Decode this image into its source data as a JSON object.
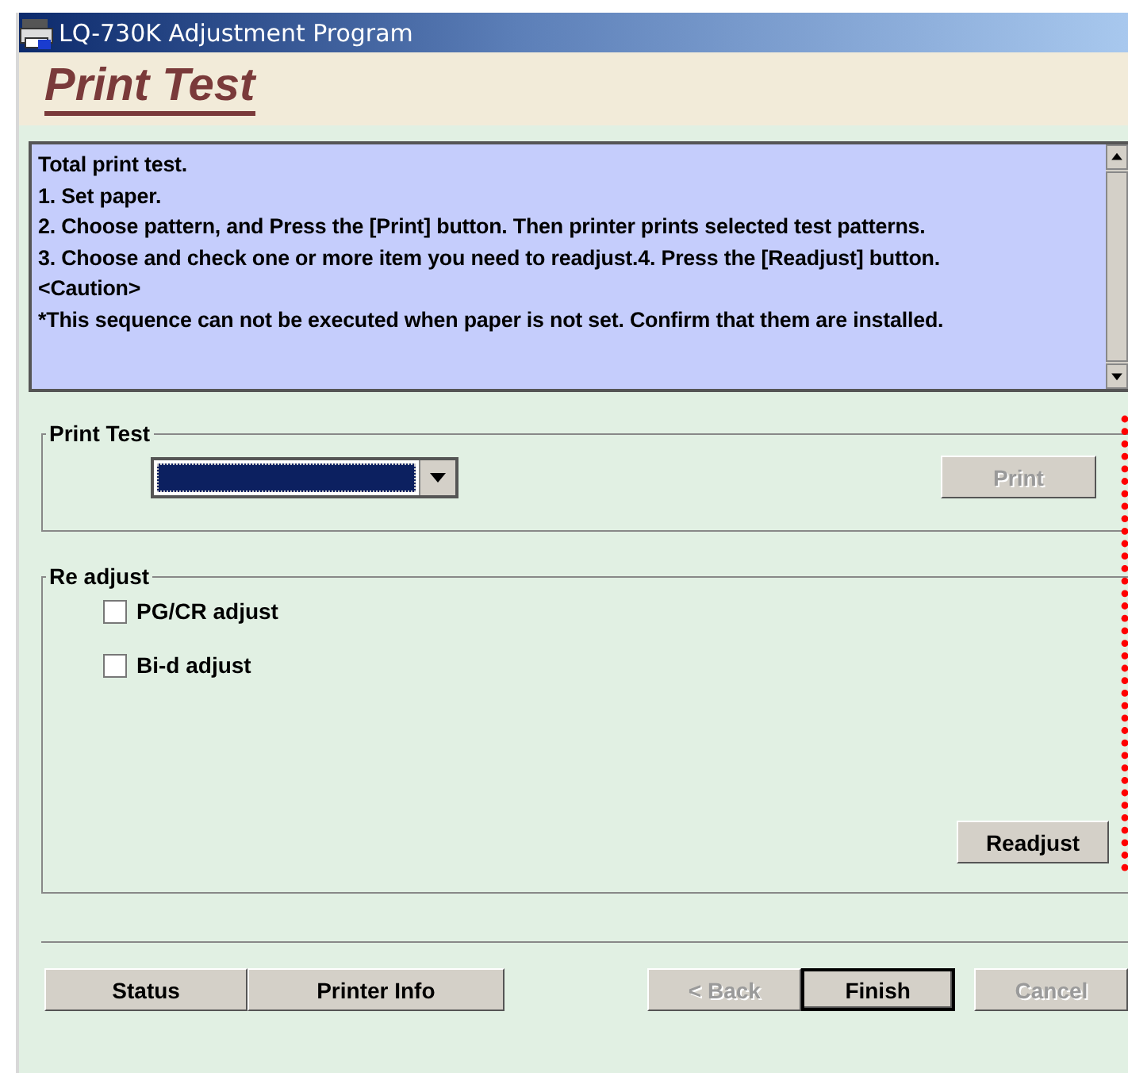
{
  "window": {
    "title": "LQ-730K Adjustment Program"
  },
  "page_title": "Print Test",
  "instructions": [
    "Total print test.",
    "1. Set paper.",
    "2. Choose pattern, and Press the [Print] button. Then printer prints selected test patterns.",
    "3. Choose and check one or more item you need to readjust.4. Press the [Readjust] button.",
    "<Caution>",
    "*This sequence can not be executed when paper is not set. Confirm that them are installed."
  ],
  "print_test": {
    "label": "Print Test",
    "dropdown": {
      "highlighted": true
    },
    "button": {
      "label": "Print",
      "disabled": true
    }
  },
  "readjust": {
    "label": "Re adjust",
    "items": [
      {
        "label": "PG/CR adjust",
        "checked": false
      },
      {
        "label": "Bi-d adjust",
        "checked": false
      }
    ],
    "button": {
      "label": "Readjust",
      "disabled": false
    }
  },
  "footer_left": [
    {
      "label": "Status",
      "disabled": false,
      "default": false
    },
    {
      "label": "Printer Info",
      "disabled": false,
      "default": false
    }
  ],
  "footer_right": [
    {
      "label": "< Back",
      "disabled": true,
      "default": false
    },
    {
      "label": "Finish",
      "disabled": false,
      "default": true
    },
    {
      "label": "Cancel",
      "disabled": true,
      "default": false
    }
  ]
}
